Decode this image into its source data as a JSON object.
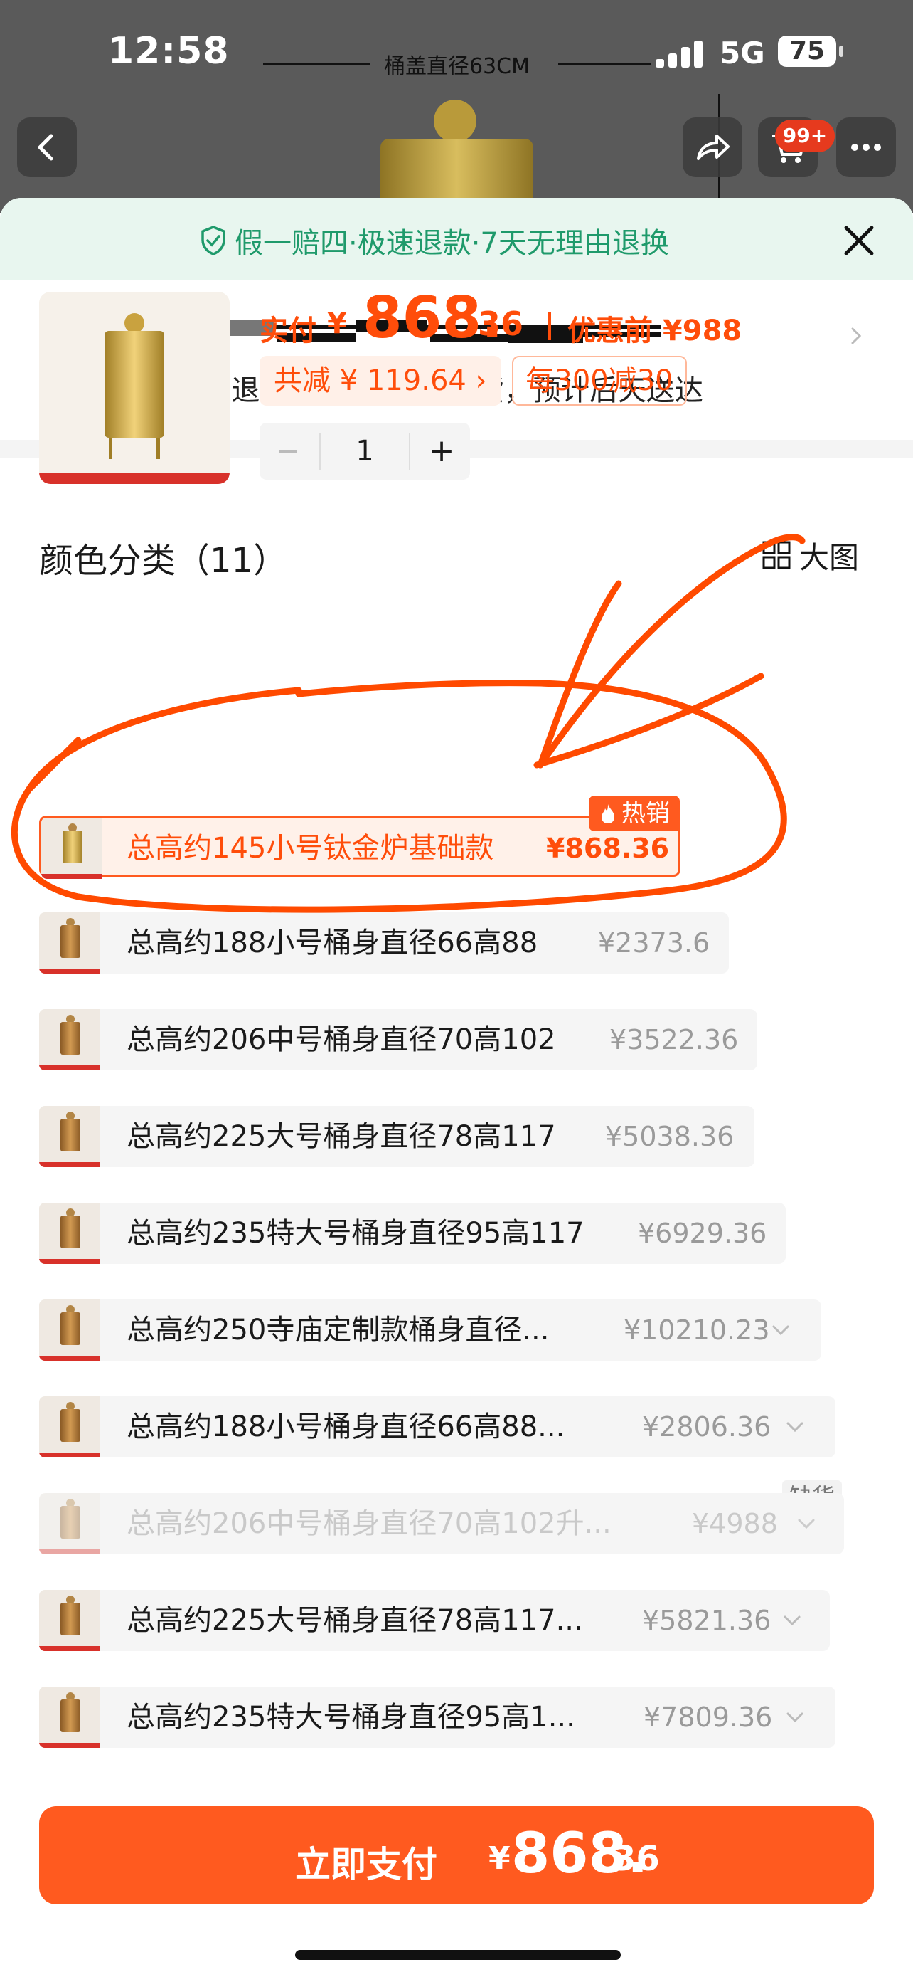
{
  "status_bar": {
    "time": "12:58",
    "network": "5G",
    "battery": "75"
  },
  "background_image": {
    "dimension_text": "桶盖直径63CM"
  },
  "nav": {
    "cart_badge": "99+"
  },
  "sheet": {
    "guarantee_text": "假一赔四·极速退款·7天无理由退换",
    "delivery_text": "快递 包邮 退货宝 48小时内发货，预计后天送达"
  },
  "product": {
    "price_label": "实付",
    "currency": "¥",
    "price_int": "868.",
    "price_dec": "36",
    "original_price": "优惠前 ¥988",
    "reduction_chip": "共减 ¥ 119.64 ›",
    "promo_chip": "每300减30",
    "quantity": "1",
    "minus": "−",
    "plus": "+"
  },
  "variants_section": {
    "title": "颜色分类（11）",
    "big_image_label": "大图",
    "hot_badge": "热销",
    "out_of_stock_badge": "缺货"
  },
  "variants": [
    {
      "name": "总高约145小号钛金炉基础款",
      "price": "¥868.36",
      "selected": true
    },
    {
      "name": "总高约188小号桶身直径66高88",
      "price": "¥2373.6"
    },
    {
      "name": "总高约206中号桶身直径70高102",
      "price": "¥3522.36"
    },
    {
      "name": "总高约225大号桶身直径78高117",
      "price": "¥5038.36"
    },
    {
      "name": "总高约235特大号桶身直径95高117",
      "price": "¥6929.36"
    },
    {
      "name": "总高约250寺庙定制款桶身直径...",
      "price": "¥10210.23"
    },
    {
      "name": "总高约188小号桶身直径66高88...",
      "price": "¥2806.36"
    },
    {
      "name": "总高约206中号桶身直径70高102升...",
      "price": "¥4988",
      "disabled": true
    },
    {
      "name": "总高约225大号桶身直径78高117...",
      "price": "¥5821.36"
    },
    {
      "name": "总高约235特大号桶身直径95高1...",
      "price": "¥7809.36"
    }
  ],
  "pay": {
    "label": "立即支付",
    "currency": "¥",
    "int": "868.",
    "dec": "36"
  },
  "colors": {
    "accent": "#ff5a1f",
    "price": "#ff4d0a",
    "guarantee_green": "#1f9a6b",
    "annotation": "#ff4a00"
  },
  "icons": [
    "back-icon",
    "share-icon",
    "cart-icon",
    "more-icon",
    "shield-check-icon",
    "close-icon",
    "chevron-right-icon",
    "grid-icon",
    "fire-icon",
    "chevron-down-icon"
  ]
}
